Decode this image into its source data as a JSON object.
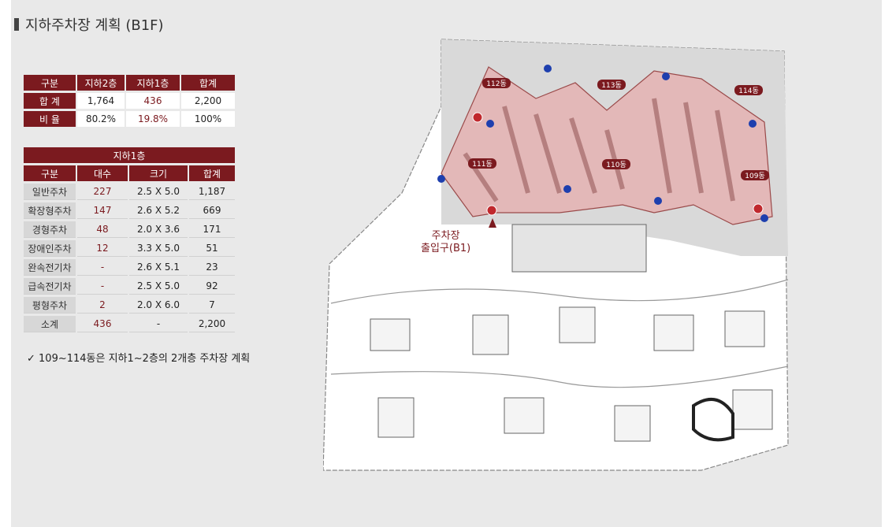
{
  "title": "지하주차장 계획 (B1F)",
  "table_summary": {
    "headers": [
      "구분",
      "지하2층",
      "지하1층",
      "합계"
    ],
    "rows": [
      {
        "label": "합 계",
        "b2": "1,764",
        "b1": "436",
        "total": "2,200"
      },
      {
        "label": "비 율",
        "b2": "80.2%",
        "b1": "19.8%",
        "total": "100%"
      }
    ]
  },
  "table_b1": {
    "title": "지하1층",
    "headers": [
      "구분",
      "대수",
      "크기",
      "합계"
    ],
    "rows": [
      {
        "type": "일반주차",
        "count": "227",
        "size": "2.5 X 5.0",
        "total": "1,187"
      },
      {
        "type": "확장형주차",
        "count": "147",
        "size": "2.6 X 5.2",
        "total": "669"
      },
      {
        "type": "경형주차",
        "count": "48",
        "size": "2.0 X 3.6",
        "total": "171"
      },
      {
        "type": "장애인주차",
        "count": "12",
        "size": "3.3 X 5.0",
        "total": "51"
      },
      {
        "type": "완속전기차",
        "count": "-",
        "size": "2.6 X 5.1",
        "total": "23"
      },
      {
        "type": "급속전기차",
        "count": "-",
        "size": "2.5 X 5.0",
        "total": "92"
      },
      {
        "type": "평형주차",
        "count": "2",
        "size": "2.0 X 6.0",
        "total": "7"
      },
      {
        "type": "소계",
        "count": "436",
        "size": "-",
        "total": "2,200"
      }
    ]
  },
  "note": "✓  109~114동은 지하1~2층의 2개층 주차장 계획",
  "map": {
    "buildings": [
      "112동",
      "113동",
      "114동",
      "111동",
      "110동",
      "109동"
    ],
    "entrance_line1": "주차장",
    "entrance_line2": "출입구(B1)",
    "colors": {
      "accent": "#7b1a1f",
      "parking": "#e3b8b8",
      "marker": "#1e3fae"
    }
  }
}
